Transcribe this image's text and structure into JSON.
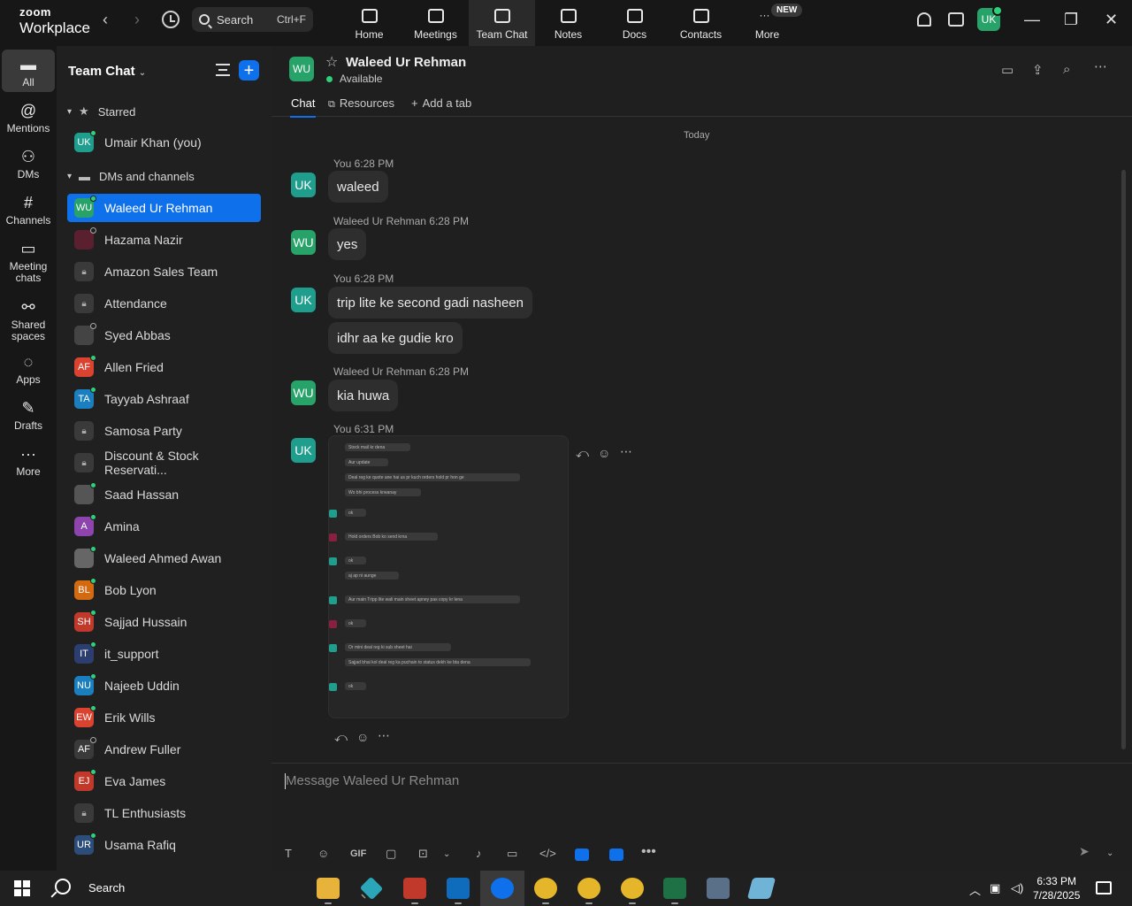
{
  "app": {
    "brand_small": "zoom",
    "brand_large": "Workplace",
    "search_placeholder": "Search",
    "search_shortcut": "Ctrl+F",
    "top_avatar_initials": "UK",
    "new_badge": "NEW"
  },
  "top_tabs": [
    {
      "label": "Home",
      "icon": "home-icon"
    },
    {
      "label": "Meetings",
      "icon": "video-icon"
    },
    {
      "label": "Team Chat",
      "icon": "chat-icon",
      "active": true
    },
    {
      "label": "Notes",
      "icon": "notes-icon"
    },
    {
      "label": "Docs",
      "icon": "docs-icon"
    },
    {
      "label": "Contacts",
      "icon": "contacts-icon"
    },
    {
      "label": "More",
      "icon": "more-icon"
    }
  ],
  "rail": [
    {
      "label": "All",
      "icon": "chat-bubble-icon",
      "active": true
    },
    {
      "label": "Mentions",
      "icon": "at-icon"
    },
    {
      "label": "DMs",
      "icon": "people-icon"
    },
    {
      "label": "Channels",
      "icon": "hash-icon"
    },
    {
      "label": "Meeting chats",
      "icon": "meeting-chat-icon"
    },
    {
      "label": "Shared spaces",
      "icon": "shared-spaces-icon"
    },
    {
      "label": "Apps",
      "icon": "apps-icon"
    },
    {
      "label": "Drafts",
      "icon": "drafts-icon"
    },
    {
      "label": "More",
      "icon": "ellipsis-icon"
    }
  ],
  "sidebar": {
    "title": "Team Chat",
    "starred_label": "Starred",
    "dms_label": "DMs and channels",
    "starred": [
      {
        "name": "Umair Khan (you)",
        "initials": "UK",
        "color": "#1f9e8e"
      }
    ],
    "contacts": [
      {
        "name": "Waleed Ur Rehman",
        "initials": "WU",
        "color": "#27a36a",
        "selected": true
      },
      {
        "name": "Hazama Nazir",
        "initials": "",
        "color": "#5a2030",
        "presence": "off"
      },
      {
        "name": "Amazon Sales Team",
        "initials": "",
        "color": "#3a3a3a",
        "lock": true
      },
      {
        "name": "Attendance",
        "initials": "",
        "color": "#3a3a3a",
        "lock": true
      },
      {
        "name": "Syed Abbas",
        "initials": "",
        "color": "#444",
        "presence": "off"
      },
      {
        "name": "Allen Fried",
        "initials": "AF",
        "color": "#d9432f"
      },
      {
        "name": "Tayyab Ashraaf",
        "initials": "TA",
        "color": "#1b7fbf"
      },
      {
        "name": "Samosa Party",
        "initials": "",
        "color": "#3a3a3a",
        "lock": true
      },
      {
        "name": "Discount & Stock Reservati...",
        "initials": "",
        "color": "#3a3a3a",
        "lock": true
      },
      {
        "name": "Saad Hassan",
        "initials": "",
        "color": "#555"
      },
      {
        "name": "Amina",
        "initials": "A",
        "color": "#8e44ad"
      },
      {
        "name": "Waleed Ahmed Awan",
        "initials": "",
        "color": "#666"
      },
      {
        "name": "Bob Lyon",
        "initials": "BL",
        "color": "#d36a12"
      },
      {
        "name": "Sajjad Hussain",
        "initials": "SH",
        "color": "#c0392b"
      },
      {
        "name": "it_support",
        "initials": "IT",
        "color": "#2c3e70"
      },
      {
        "name": "Najeeb Uddin",
        "initials": "NU",
        "color": "#1b7fbf"
      },
      {
        "name": "Erik Wills",
        "initials": "EW",
        "color": "#d9432f"
      },
      {
        "name": "Andrew Fuller",
        "initials": "AF",
        "color": "#3a3a3a",
        "presence": "off"
      },
      {
        "name": "Eva James",
        "initials": "EJ",
        "color": "#c0392b"
      },
      {
        "name": "TL Enthusiasts",
        "initials": "",
        "color": "#3a3a3a",
        "lock": true
      },
      {
        "name": "Usama Rafiq",
        "initials": "UR",
        "color": "#2c4d7a"
      }
    ]
  },
  "chat": {
    "header_initials": "WU",
    "header_name": "Waleed Ur Rehman",
    "header_status": "Available",
    "tabs": [
      "Chat",
      "Resources",
      "Add a tab"
    ],
    "day": "Today",
    "messages": [
      {
        "sender": "You",
        "time": "6:28 PM",
        "initials": "UK",
        "bubbles": [
          "waleed"
        ]
      },
      {
        "sender": "Waleed Ur Rehman",
        "time": "6:28 PM",
        "initials": "WU",
        "bubbles": [
          "yes"
        ]
      },
      {
        "sender": "You",
        "time": "6:28 PM",
        "initials": "UK",
        "bubbles": [
          "trip lite ke second gadi nasheen",
          "idhr aa ke gudie kro"
        ]
      },
      {
        "sender": "Waleed Ur Rehman",
        "time": "6:28 PM",
        "initials": "WU",
        "bubbles": [
          "kia huwa"
        ]
      },
      {
        "sender": "You",
        "time": "6:31 PM",
        "initials": "UK",
        "bubbles": []
      }
    ],
    "screenshot_lines": [
      "Stock mail kr dena",
      "Aur update",
      "Deal reg ke quote ane hai us pr kuch orders hold pr hon ge",
      "Wo bhi process krwanay",
      "ok",
      "Hold orders Bob ko send krna",
      "ok",
      "aj ap ni aunge",
      "Aur main Tripp lite wali main sheet apney pas copy kr lena",
      "ok",
      "Or mini deal reg ki sub sheet hai",
      "Sajjad bhai kol deal reg ka puchain to status dekh ke bta dena",
      "ok"
    ],
    "composer_placeholder": "Message Waleed Ur Rehman",
    "gif_label": "GIF"
  },
  "taskbar": {
    "search_label": "Search",
    "time": "6:33 PM",
    "date": "7/28/2025"
  }
}
